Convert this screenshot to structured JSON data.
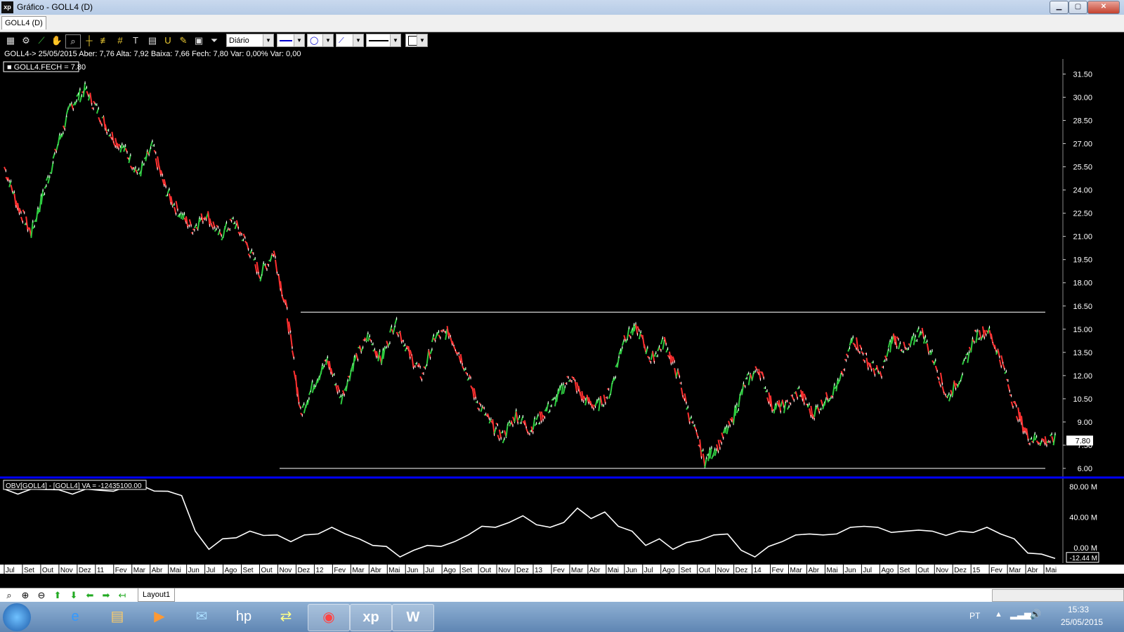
{
  "window": {
    "title": "Gráfico - GOLL4 (D)",
    "app_icon": "xp",
    "min": "▁",
    "max": "▢",
    "close": "✕"
  },
  "tab": {
    "label": "GOLL4 (D)"
  },
  "toolbar": {
    "icons": [
      "chart-icon",
      "gear-icon",
      "trend-icon",
      "hand-icon",
      "zoom-area-icon",
      "crosshair-icon",
      "fibonacci-icon",
      "grid-icon",
      "text-icon",
      "calculator-icon",
      "magnet-icon",
      "pen-icon",
      "bag-icon",
      "filter-icon"
    ],
    "period": "Diário"
  },
  "info": {
    "line": "GOLL4-> 25/05/2015 Aber: 7,76 Alta: 7,92 Baixa: 7,66 Fech: 7,80 Var: 0,00% Var: 0,00"
  },
  "chart_data": {
    "type": "line",
    "price_legend": "GOLL4.FECH = 7.80",
    "obv_legend": "OBV[GOLL4] - [GOLL4] VA = -12435100.00",
    "price_ticks": [
      "31.50",
      "30.00",
      "28.50",
      "27.00",
      "25.50",
      "24.00",
      "22.50",
      "21.00",
      "19.50",
      "18.00",
      "16.50",
      "15.00",
      "13.50",
      "12.00",
      "10.50",
      "9.00",
      "7.50",
      "6.00"
    ],
    "last_price": "7.80",
    "obv_ticks": [
      "80.00 M",
      "40.00 M",
      "0.00 M"
    ],
    "last_obv": "-12.44 M",
    "months": [
      "Jul",
      "Set",
      "Out",
      "Nov",
      "Dez",
      "11",
      "Fev",
      "Mar",
      "Abr",
      "Mai",
      "Jun",
      "Jul",
      "Ago",
      "Set",
      "Out",
      "Nov",
      "Dez",
      "12",
      "Fev",
      "Mar",
      "Abr",
      "Mai",
      "Jun",
      "Jul",
      "Ago",
      "Set",
      "Out",
      "Nov",
      "Dez",
      "13",
      "Fev",
      "Mar",
      "Abr",
      "Mai",
      "Jun",
      "Jul",
      "Ago",
      "Set",
      "Out",
      "Nov",
      "Dez",
      "14",
      "Fev",
      "Mar",
      "Abr",
      "Mai",
      "Jun",
      "Jul",
      "Ago",
      "Set",
      "Out",
      "Nov",
      "Dez",
      "15",
      "Fev",
      "Mar",
      "Abr",
      "Mai"
    ],
    "price_range": [
      5.5,
      32.2
    ],
    "close_series": [
      25.5,
      23.0,
      21.2,
      24.0,
      27.0,
      29.5,
      30.5,
      29.0,
      27.5,
      26.5,
      25.0,
      26.8,
      24.0,
      22.5,
      21.5,
      22.5,
      21.0,
      22.0,
      20.5,
      18.5,
      20.0,
      16.0,
      9.5,
      11.5,
      13.0,
      10.5,
      13.0,
      14.5,
      13.0,
      15.5,
      13.5,
      12.0,
      14.5,
      14.8,
      13.0,
      10.5,
      9.0,
      8.0,
      9.5,
      8.5,
      9.5,
      10.5,
      12.0,
      10.5,
      10.0,
      11.0,
      14.5,
      15.0,
      13.0,
      14.2,
      12.0,
      9.0,
      6.5,
      7.5,
      9.0,
      11.5,
      12.5,
      10.0,
      10.0,
      11.0,
      9.5,
      10.5,
      11.5,
      14.5,
      13.0,
      12.0,
      14.5,
      13.5,
      15.0,
      13.0,
      10.5,
      12.0,
      14.5,
      15.0,
      13.0,
      10.0,
      8.0,
      7.8,
      7.8
    ],
    "resistance": 16.1,
    "support": 6.0,
    "obv_range": [
      -20,
      90
    ],
    "obv_series": [
      75,
      72,
      75,
      78,
      74,
      72,
      75,
      77,
      72,
      82,
      80,
      76,
      72,
      70,
      20,
      0,
      10,
      15,
      20,
      18,
      15,
      10,
      15,
      20,
      25,
      20,
      10,
      5,
      0,
      -10,
      -5,
      5,
      0,
      10,
      15,
      30,
      25,
      35,
      40,
      32,
      25,
      35,
      50,
      40,
      45,
      30,
      20,
      5,
      10,
      0,
      5,
      12,
      15,
      20,
      -5,
      -10,
      0,
      10,
      15,
      20,
      15,
      20,
      25,
      30,
      25,
      22,
      20,
      25,
      20,
      18,
      20,
      22,
      25,
      20,
      10,
      -5,
      -10,
      -12
    ]
  },
  "bottom": {
    "layout_tab": "Layout1",
    "icons": [
      "zoom-icon",
      "zoom-in-icon",
      "zoom-out-icon",
      "up-arrow-icon",
      "down-arrow-icon",
      "left-arrow-icon",
      "right-arrow-icon",
      "first-icon"
    ]
  },
  "taskbar": {
    "apps": [
      "ie-icon",
      "explorer-icon",
      "media-icon",
      "outlook-icon",
      "hp-icon",
      "sync-icon",
      "chrome-icon",
      "xp-icon",
      "word-icon"
    ],
    "lang": "PT",
    "time": "15:33",
    "date": "25/05/2015"
  }
}
